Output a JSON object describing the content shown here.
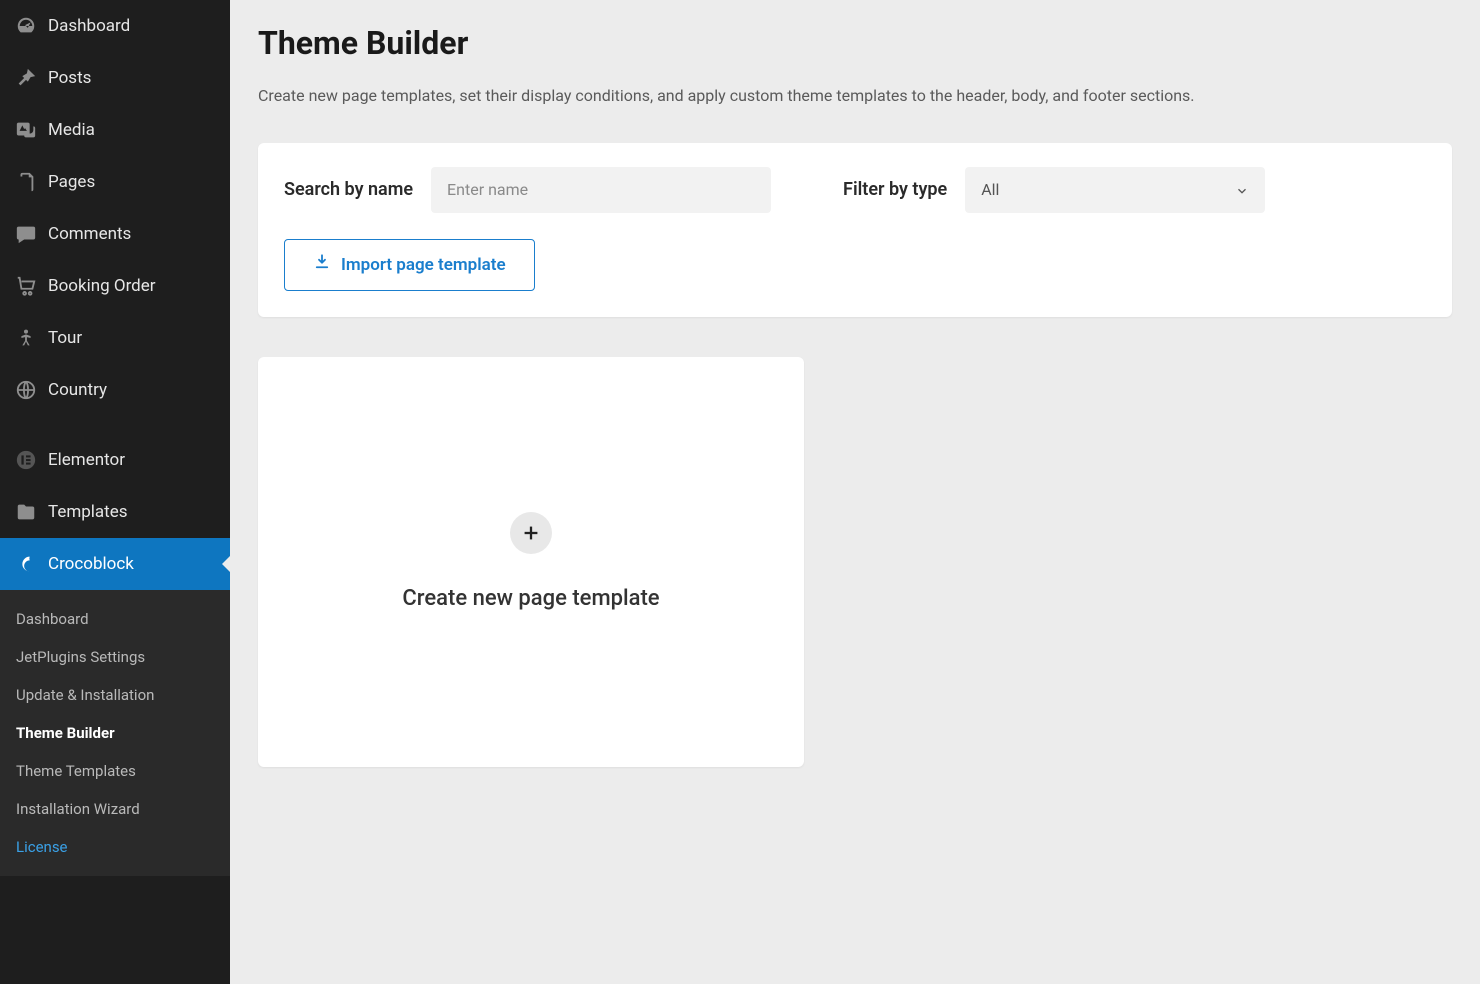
{
  "sidebar": {
    "items": [
      {
        "id": "dashboard",
        "label": "Dashboard",
        "icon": "gauge"
      },
      {
        "id": "posts",
        "label": "Posts",
        "icon": "pin"
      },
      {
        "id": "media",
        "label": "Media",
        "icon": "media"
      },
      {
        "id": "pages",
        "label": "Pages",
        "icon": "page"
      },
      {
        "id": "comments",
        "label": "Comments",
        "icon": "chat"
      },
      {
        "id": "booking-order",
        "label": "Booking Order",
        "icon": "cart"
      },
      {
        "id": "tour",
        "label": "Tour",
        "icon": "person"
      },
      {
        "id": "country",
        "label": "Country",
        "icon": "globe"
      },
      {
        "id": "elementor",
        "label": "Elementor",
        "icon": "elementor"
      },
      {
        "id": "templates",
        "label": "Templates",
        "icon": "folder"
      },
      {
        "id": "crocoblock",
        "label": "Crocoblock",
        "icon": "croco",
        "active": true
      }
    ],
    "submenu": [
      {
        "id": "sub-dashboard",
        "label": "Dashboard"
      },
      {
        "id": "sub-jetplugins",
        "label": "JetPlugins Settings"
      },
      {
        "id": "sub-update",
        "label": "Update & Installation"
      },
      {
        "id": "sub-theme-builder",
        "label": "Theme Builder",
        "current": true
      },
      {
        "id": "sub-theme-templates",
        "label": "Theme Templates"
      },
      {
        "id": "sub-install-wizard",
        "label": "Installation Wizard"
      },
      {
        "id": "sub-license",
        "label": "License",
        "link": true
      }
    ]
  },
  "page": {
    "title": "Theme Builder",
    "description": "Create new page templates, set their display conditions, and apply custom theme templates to the header, body, and footer sections."
  },
  "filters": {
    "search_label": "Search by name",
    "search_placeholder": "Enter name",
    "type_label": "Filter by type",
    "type_value": "All",
    "import_btn": "Import page template"
  },
  "create_card": {
    "label": "Create new page template"
  }
}
